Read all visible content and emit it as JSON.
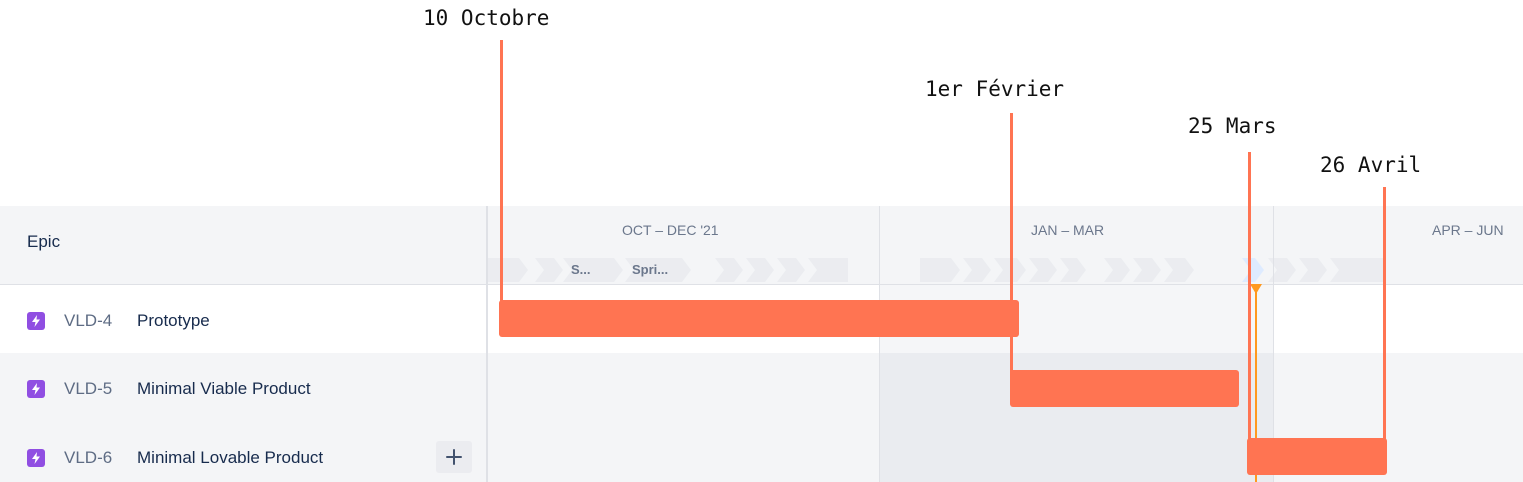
{
  "annotations": [
    {
      "label": "10 Octobre"
    },
    {
      "label": "1er Février"
    },
    {
      "label": "25 Mars"
    },
    {
      "label": "26 Avril"
    }
  ],
  "timeline": {
    "header_label": "Epic",
    "quarters": [
      "OCT – DEC '21",
      "JAN – MAR",
      "APR – JUN"
    ],
    "sprint_labels": [
      "S...",
      "Spri..."
    ]
  },
  "epics": [
    {
      "key": "VLD-4",
      "name": "Prototype",
      "icon": "epic-lightning-icon"
    },
    {
      "key": "VLD-5",
      "name": "Minimal Viable Product",
      "icon": "epic-lightning-icon"
    },
    {
      "key": "VLD-6",
      "name": "Minimal Lovable Product",
      "icon": "epic-lightning-icon"
    }
  ],
  "add_button": {
    "icon": "plus-icon"
  },
  "colors": {
    "bar": "#ff7452",
    "epic_icon": "#904ee2",
    "today_marker": "#ff991f",
    "header_bg": "#f4f5f7"
  }
}
